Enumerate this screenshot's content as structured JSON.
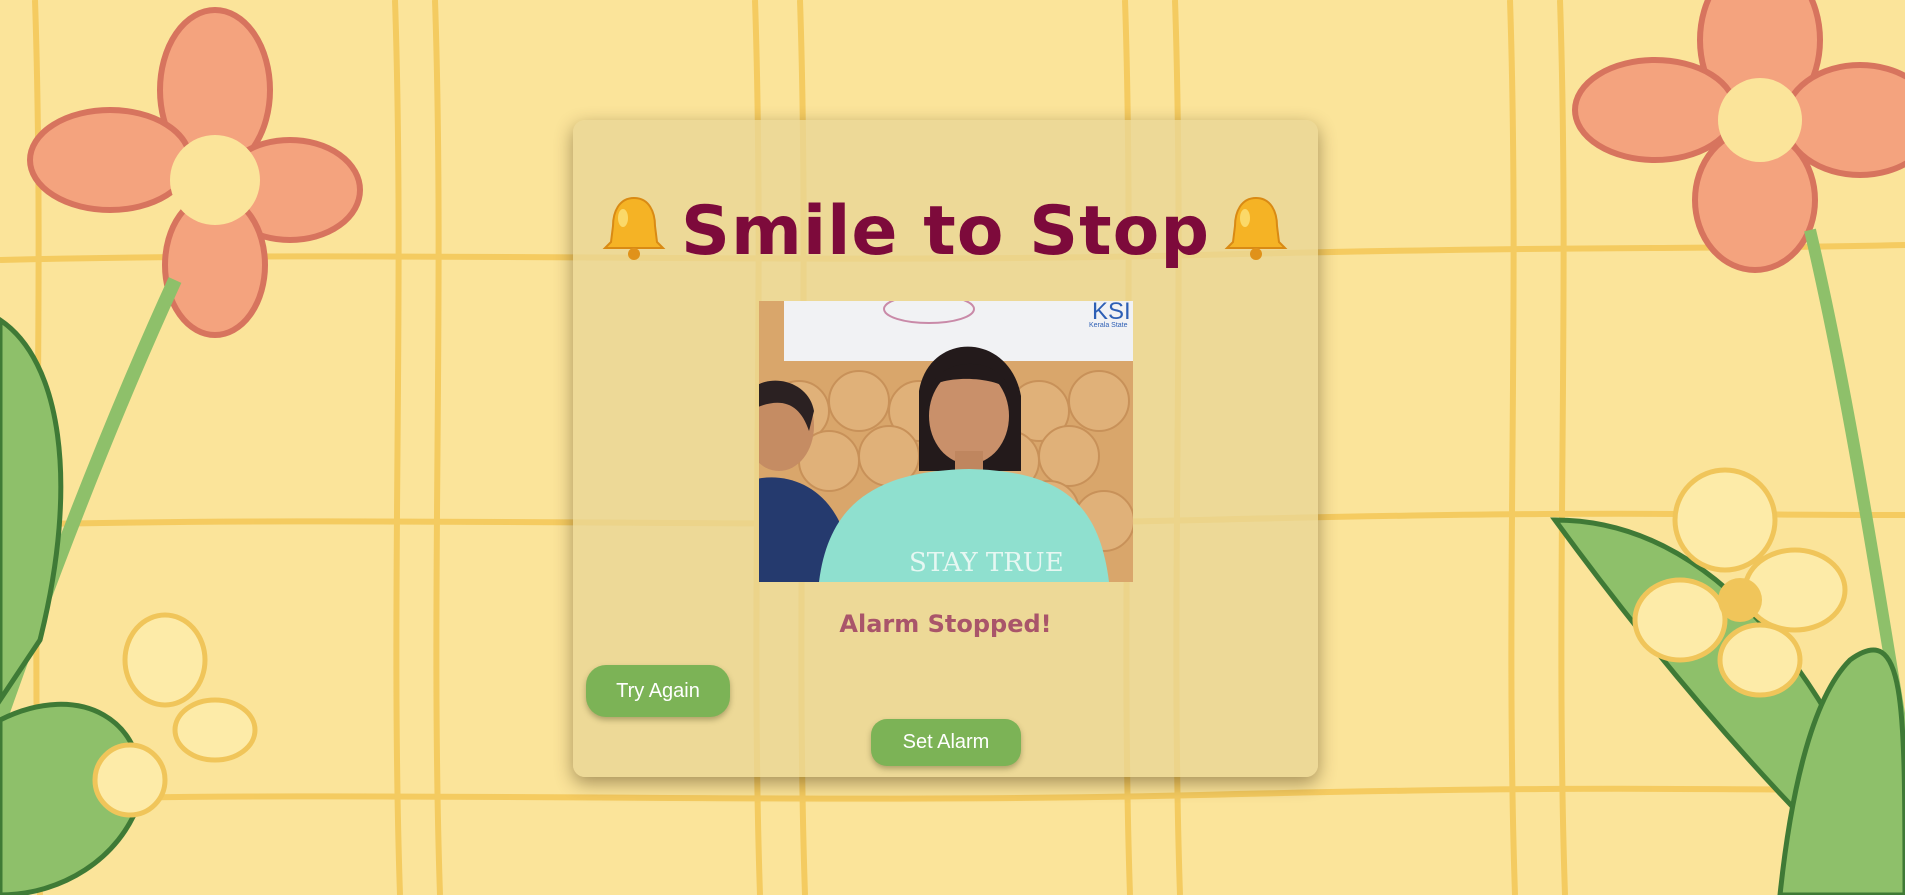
{
  "app": {
    "title": "Smile to Stop",
    "status": "Alarm Stopped!"
  },
  "buttons": {
    "try_again": "Try Again",
    "set_alarm": "Set Alarm"
  },
  "camera": {
    "board_text": "KSI",
    "board_subtext": "Kerala State",
    "shirt_text": "STAY TRUE"
  },
  "colors": {
    "title": "#7d0a3b",
    "status": "#a9556a",
    "button": "#7cb356",
    "background": "#fbe49a"
  },
  "icons": {
    "title_left": "bell-icon",
    "title_right": "bell-icon"
  }
}
